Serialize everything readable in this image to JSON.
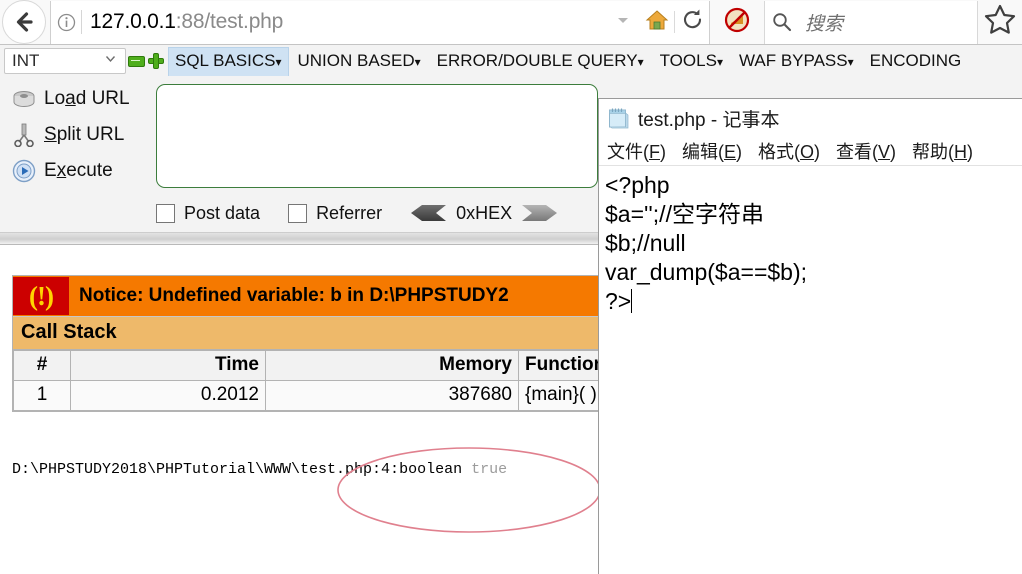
{
  "browser": {
    "url_main": "127.0.0.1",
    "url_rest": ":88/test.php",
    "search_placeholder": "搜索",
    "icons": {
      "back": "back-arrow-icon",
      "identity": "info-circle-icon",
      "dropdown": "chevron-down-icon",
      "home": "home-icon",
      "reload": "reload-icon",
      "noscript": "noscript-blocked-icon",
      "search": "search-icon",
      "bookmark": "star-bookmark-icon"
    }
  },
  "hackbar": {
    "type_select": {
      "value": "INT"
    },
    "buttons": {
      "minus": "−",
      "plus": "+"
    },
    "menu": [
      {
        "label": "SQL BASICS",
        "active": true
      },
      {
        "label": "UNION BASED",
        "active": false
      },
      {
        "label": "ERROR/DOUBLE QUERY",
        "active": false
      },
      {
        "label": "TOOLS",
        "active": false
      },
      {
        "label": "WAF BYPASS",
        "active": false
      },
      {
        "label": "ENCODING",
        "active": false
      }
    ],
    "actions": [
      {
        "label_pre": "Lo",
        "label_key": "a",
        "label_post": "d URL",
        "icon": "load-url-icon"
      },
      {
        "label_pre": "",
        "label_key": "S",
        "label_post": "plit URL",
        "icon": "split-url-icon"
      },
      {
        "label_pre": "E",
        "label_key": "x",
        "label_post": "ecute",
        "icon": "execute-icon"
      }
    ],
    "url_field_value": "",
    "checkboxes": [
      {
        "label": "Post data",
        "checked": false
      },
      {
        "label": "Referrer",
        "checked": false
      }
    ],
    "hex_label": "0xHEX"
  },
  "page": {
    "notice": {
      "icon_glyph": "(!)",
      "text": "Notice: Undefined variable: b in D:\\PHPSTUDY2"
    },
    "call_stack": {
      "title": "Call Stack",
      "headers": [
        "#",
        "Time",
        "Memory",
        "Function"
      ],
      "rows": [
        [
          "1",
          "0.2012",
          "387680",
          "{main}( )"
        ]
      ]
    },
    "dump_path": "D:\\PHPSTUDY2018\\PHPTutorial\\WWW\\test.php:4:boolean ",
    "dump_value": "true",
    "annotation": "red-ellipse-highlight"
  },
  "notepad": {
    "title": "test.php - 记事本",
    "icon": "notepad-icon",
    "menu": [
      {
        "pre": "文件(",
        "key": "F",
        "post": ")"
      },
      {
        "pre": "编辑(",
        "key": "E",
        "post": ")"
      },
      {
        "pre": "格式(",
        "key": "O",
        "post": ")"
      },
      {
        "pre": "查看(",
        "key": "V",
        "post": ")"
      },
      {
        "pre": "帮助(",
        "key": "H",
        "post": ")"
      }
    ],
    "content": "<?php\n$a='';//空字符串\n$b;//null\nvar_dump($a==$b);\n?>"
  },
  "colors": {
    "notice_bg": "#f57900",
    "notice_icon_bg": "#cc0000",
    "notice_icon_fg": "#ffd500",
    "callstack_header_bg": "#eeb96a",
    "hackbar_accent": "#cfe2f3",
    "textarea_border": "#3c7d3c",
    "annotation": "#e58b96"
  }
}
